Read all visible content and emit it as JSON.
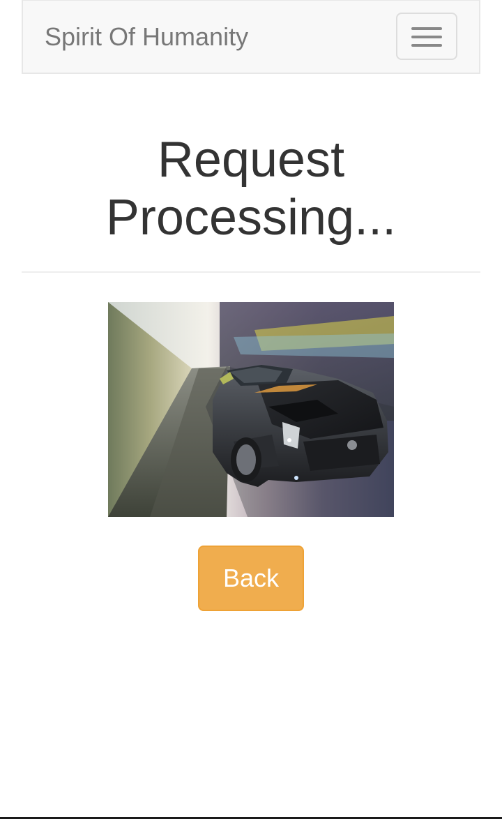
{
  "navbar": {
    "brand": "Spirit Of Humanity",
    "toggle_icon": "hamburger-menu-icon"
  },
  "main": {
    "heading": "Request Processing...",
    "image": {
      "subject": "concept car speeding through a motion-blurred tunnel"
    },
    "back_button_label": "Back"
  },
  "colors": {
    "navbar_background": "#f8f8f8",
    "brand_text": "#777777",
    "heading_text": "#333333",
    "warning_button": "#f0ad4e",
    "warning_button_border": "#eea236"
  }
}
